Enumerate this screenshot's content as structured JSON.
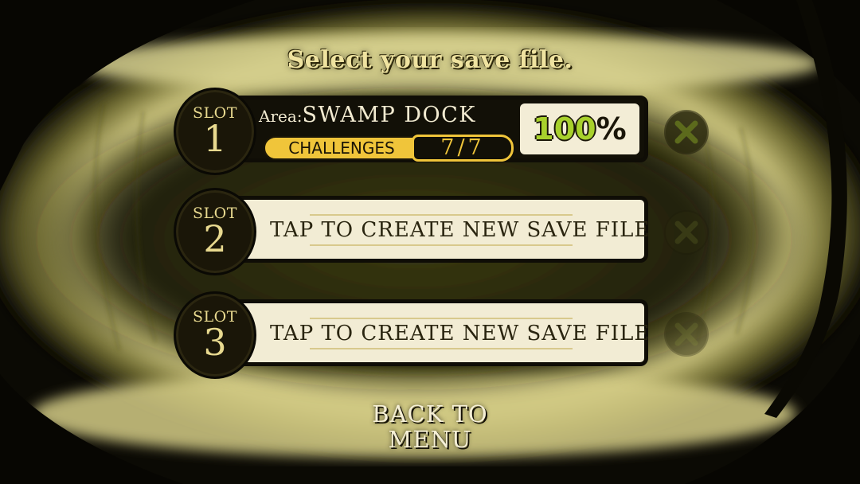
{
  "title": "Select your save file.",
  "slots": [
    {
      "label": "SLOT",
      "number": "1",
      "area_label": "Area:",
      "area_value": "SWAMP DOCK",
      "challenges_label": "CHALLENGES",
      "challenges_value": "7/7",
      "challenges_completed": 7,
      "challenges_total": 7,
      "percent_value": "100",
      "percent_sign": "%"
    },
    {
      "label": "SLOT",
      "number": "2",
      "create_text": "TAP TO CREATE NEW SAVE FILE"
    },
    {
      "label": "SLOT",
      "number": "3",
      "create_text": "TAP TO CREATE NEW SAVE FILE"
    }
  ],
  "delete_icon": "close-x-icon",
  "back_button": {
    "line1": "BACK TO",
    "line2": "MENU"
  },
  "colors": {
    "background": "#0b0a04",
    "glow": "#d9d28a",
    "gold": "#f0c53a",
    "panel_light": "#f2ecd4",
    "percent_green": "#a8d12c"
  }
}
